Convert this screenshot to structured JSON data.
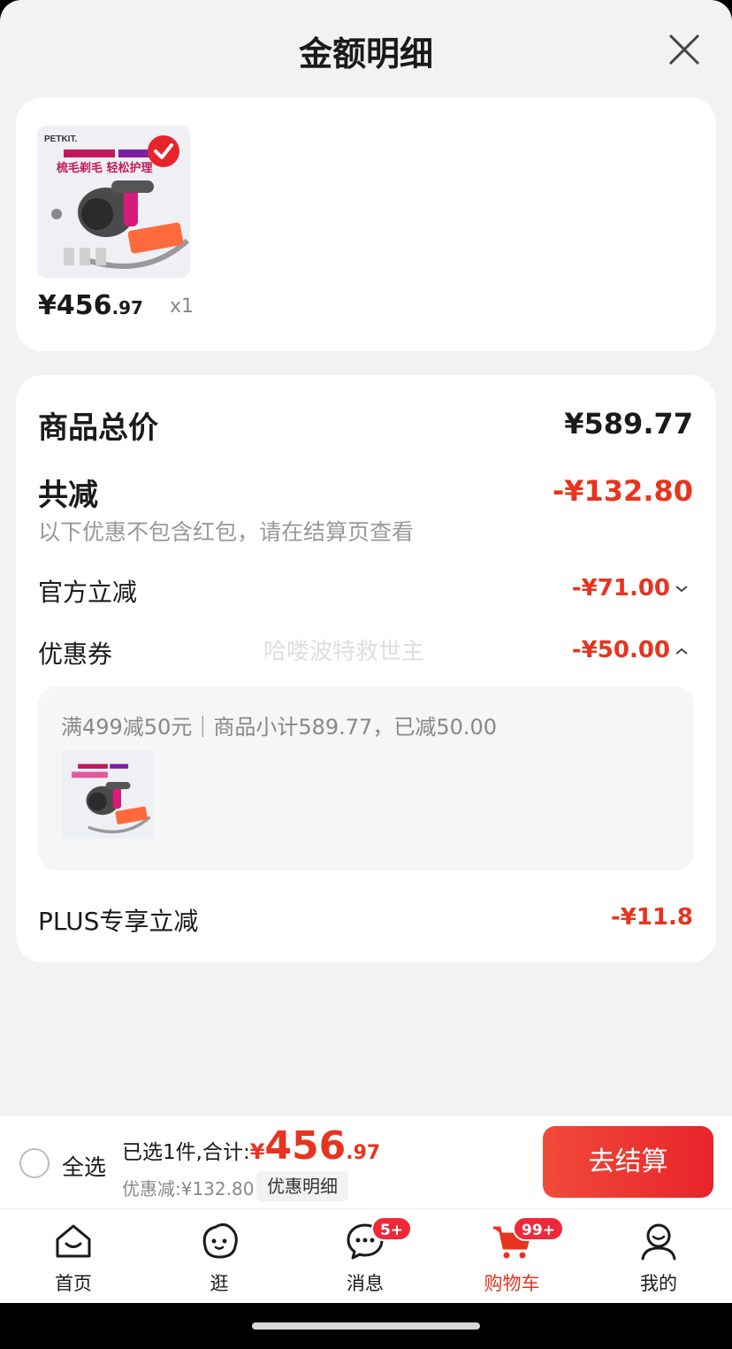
{
  "header": {
    "title": "金额明细"
  },
  "product": {
    "price_main": "¥456",
    "price_decimal": ".97",
    "quantity": "x1",
    "thumb_brand": "PETKIT.",
    "thumb_slogan": "梳毛剃毛 轻松护理"
  },
  "detail": {
    "total_label": "商品总价",
    "total_value": "¥589.77",
    "reduce_label": "共减",
    "reduce_value": "-¥132.80",
    "note": "以下优惠不包含红包，请在结算页查看",
    "official_label": "官方立减",
    "official_value": "-¥71.00",
    "coupon_label": "优惠券",
    "coupon_value": "-¥50.00",
    "watermark": "哈喽波特救世主",
    "coupon_desc": "满499减50元｜商品小计589.77，已减50.00",
    "plus_label": "PLUS专享立减",
    "plus_value": "-¥11.8"
  },
  "checkout": {
    "select_all": "全选",
    "selected_text": "已选1件,合计:",
    "currency": "¥",
    "amount_int": "456",
    "amount_dec": ".97",
    "discount_text": "优惠减:¥132.80",
    "detail_link": "优惠明细",
    "button": "去结算"
  },
  "tabs": [
    {
      "label": "首页",
      "icon": "home-icon"
    },
    {
      "label": "逛",
      "icon": "browse-icon"
    },
    {
      "label": "消息",
      "icon": "message-icon",
      "badge": "5+"
    },
    {
      "label": "购物车",
      "icon": "cart-icon",
      "badge": "99+",
      "active": true
    },
    {
      "label": "我的",
      "icon": "profile-icon"
    }
  ],
  "colors": {
    "accent": "#e8341e",
    "background": "#f2f2f2"
  }
}
